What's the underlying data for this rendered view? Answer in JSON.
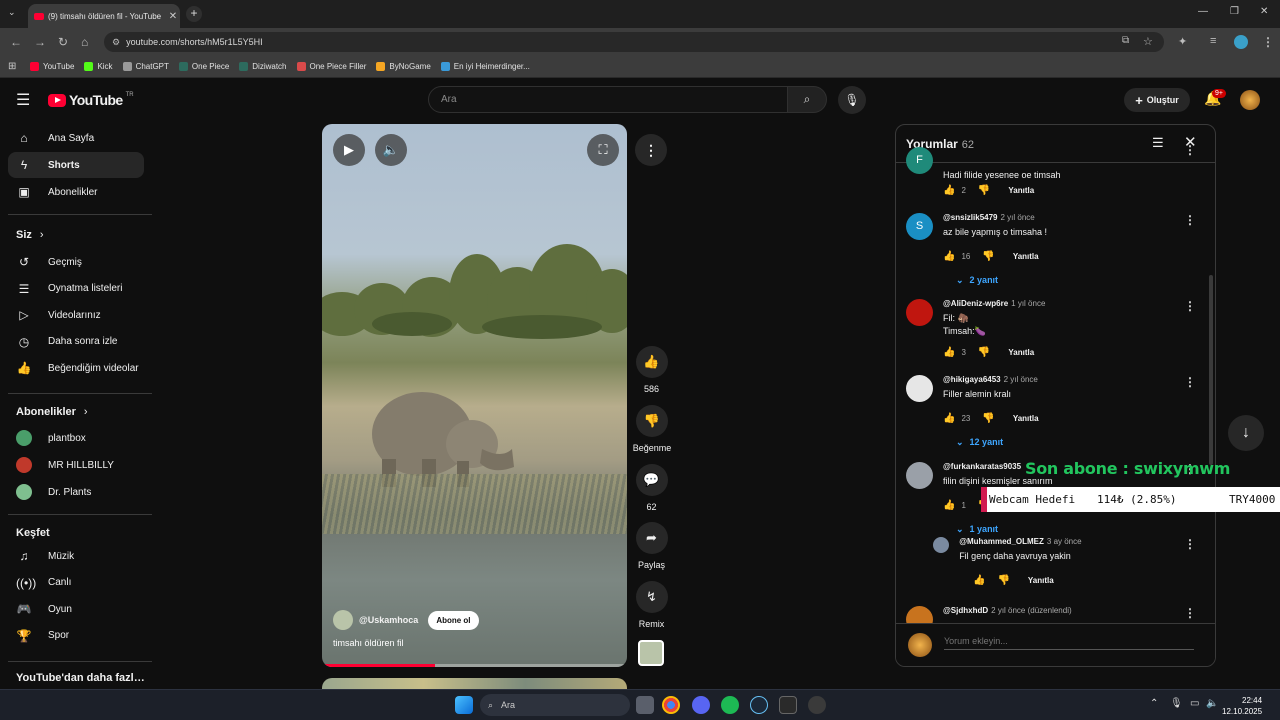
{
  "browser": {
    "tab_title": "(9) timsahı öldüren fil - YouTube",
    "url": "youtube.com/shorts/hM5r1L5Y5HI",
    "bookmarks": [
      {
        "label": "YouTube",
        "color": "#ff0033"
      },
      {
        "label": "Kick",
        "color": "#53fc18"
      },
      {
        "label": "ChatGPT",
        "color": "#9a9a9a"
      },
      {
        "label": "One Piece",
        "color": "#2d6b5e"
      },
      {
        "label": "Diziwatch",
        "color": "#2d6b5e"
      },
      {
        "label": "One Piece Filler",
        "color": "#d94a4a"
      },
      {
        "label": "ByNoGame",
        "color": "#f5a623"
      },
      {
        "label": "En iyi Heimerdinger...",
        "color": "#3a9ad9"
      }
    ]
  },
  "youtube": {
    "logo_text": "YouTube",
    "logo_region": "TR",
    "search_placeholder": "Ara",
    "create_label": "Oluştur",
    "notifications_badge": "9+"
  },
  "sidebar": {
    "main": [
      {
        "label": "Ana Sayfa",
        "icon": "home-icon",
        "glyph": "⌂"
      },
      {
        "label": "Shorts",
        "icon": "shorts-icon",
        "glyph": "ϟ"
      },
      {
        "label": "Abonelikler",
        "icon": "subscriptions-icon",
        "glyph": "▣"
      }
    ],
    "you_header": "Siz",
    "you": [
      {
        "label": "Geçmiş",
        "icon": "history-icon",
        "glyph": "↺"
      },
      {
        "label": "Oynatma listeleri",
        "icon": "playlists-icon",
        "glyph": "☰"
      },
      {
        "label": "Videolarınız",
        "icon": "your-videos-icon",
        "glyph": "▷"
      },
      {
        "label": "Daha sonra izle",
        "icon": "watch-later-icon",
        "glyph": "◷"
      },
      {
        "label": "Beğendiğim videolar",
        "icon": "liked-videos-icon",
        "glyph": "👍"
      }
    ],
    "subs_header": "Abonelikler",
    "subs": [
      {
        "label": "plantbox",
        "color": "#4a9e6a"
      },
      {
        "label": "MR HILLBILLY",
        "color": "#c0392b"
      },
      {
        "label": "Dr. Plants",
        "color": "#7fbf8f"
      }
    ],
    "explore_header": "Keşfet",
    "explore": [
      {
        "label": "Müzik",
        "icon": "music-icon",
        "glyph": "♫"
      },
      {
        "label": "Canlı",
        "icon": "live-icon",
        "glyph": "((•))"
      },
      {
        "label": "Oyun",
        "icon": "gaming-icon",
        "glyph": "🎮"
      },
      {
        "label": "Spor",
        "icon": "sports-icon",
        "glyph": "🏆"
      }
    ],
    "more_header": "YouTube'dan daha fazlası"
  },
  "video": {
    "channel": "@Uskamhoca",
    "subscribe_label": "Abone ol",
    "title": "timsahı öldüren fil",
    "progress": 0.37
  },
  "actions": {
    "likes": "586",
    "dislike_label": "Beğenme",
    "comments": "62",
    "share_label": "Paylaş",
    "remix_label": "Remix"
  },
  "comments": {
    "title": "Yorumlar",
    "count": "62",
    "input_placeholder": "Yorum ekleyin...",
    "items": [
      {
        "author": "",
        "ago": "",
        "text": "Hadi filide yesenee oe timsah",
        "likes": "2",
        "reply": "Yanıtla",
        "avatar_color": "#1f8a7a",
        "avatar_letter": "F"
      },
      {
        "author": "@snsizlik5479",
        "ago": "2 yıl önce",
        "text": "az bile yapmış o timsaha !",
        "likes": "16",
        "reply": "Yanıtla",
        "replies": "2 yanıt",
        "avatar_color": "#1a8fc4",
        "avatar_letter": "S"
      },
      {
        "author": "@AliDeniz-wp6re",
        "ago": "1 yıl önce",
        "text": "Fil: 🦣",
        "text2": "Timsah:🍆",
        "likes": "3",
        "reply": "Yanıtla",
        "avatar_color": "#c0160f",
        "avatar_letter": ""
      },
      {
        "author": "@hikigaya6453",
        "ago": "2 yıl önce",
        "text": "Filler alemin kralı",
        "likes": "23",
        "reply": "Yanıtla",
        "replies": "12 yanıt",
        "avatar_color": "#e6e6e6",
        "avatar_letter": ""
      },
      {
        "author": "@furkankaratas9035",
        "ago": "",
        "text": "filin dişini kesmişler sanırım",
        "likes": "1",
        "reply": "Yanıtla",
        "replies": "1 yanıt",
        "avatar_color": "#9aa0a8",
        "avatar_letter": ""
      },
      {
        "author": "@Muhammed_OLMEZ",
        "ago": "3 ay önce",
        "text": "Fil genç daha yavruya yakin",
        "likes": "",
        "reply": "Yanıtla",
        "avatar_color": "#7a8aa0",
        "avatar_letter": ""
      },
      {
        "author": "@SjdhxhdD",
        "ago": "2 yıl önce (düzenlendi)",
        "text": "",
        "likes": "",
        "reply": "",
        "avatar_color": "#c8731e",
        "avatar_letter": ""
      }
    ]
  },
  "overlay": {
    "last_sub": "Son abone : swixymwm",
    "goal_label": "Webcam Hedefi",
    "goal_progress": "114₺ (2.85%)",
    "goal_target": "TRY4000"
  },
  "taskbar": {
    "search_placeholder": "Ara",
    "time": "22:44",
    "date": "12.10.2025"
  }
}
